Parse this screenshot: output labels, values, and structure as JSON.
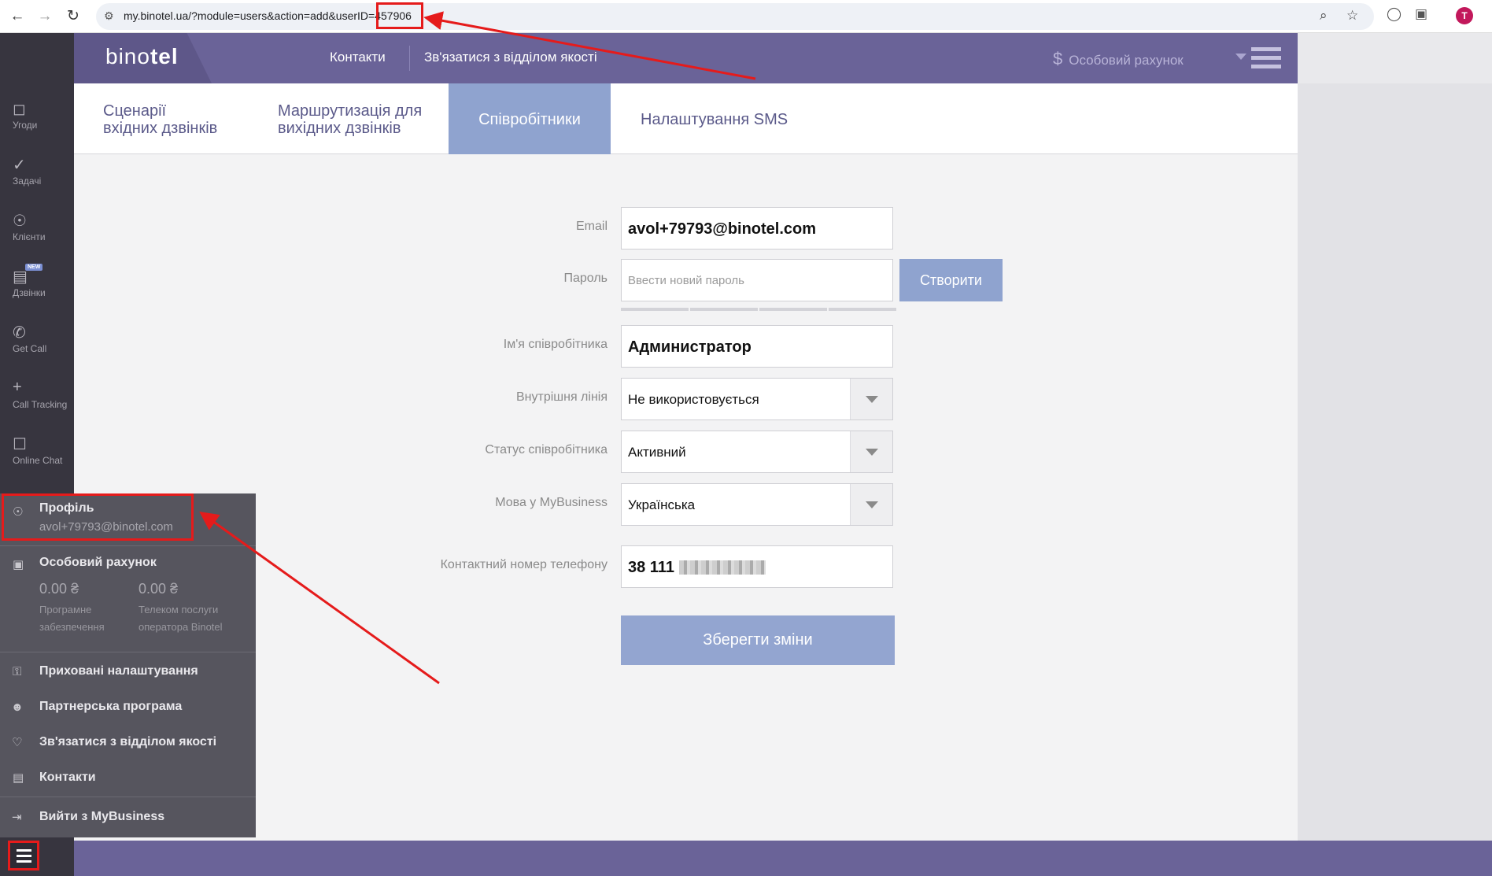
{
  "browser": {
    "url_prefix": "my.binotel.ua/?module=users&action=add&userID=",
    "url_id": "457906",
    "avatar_letter": "T"
  },
  "sidebar": {
    "items": [
      {
        "label": "Угоди",
        "icon": "deals-icon"
      },
      {
        "label": "Задачі",
        "icon": "check-icon"
      },
      {
        "label": "Клієнти",
        "icon": "person-icon"
      },
      {
        "label": "Дзвінки",
        "icon": "calls-icon",
        "badge": "NEW"
      },
      {
        "label": "Get Call",
        "icon": "phone-icon"
      },
      {
        "label": "Call Tracking",
        "icon": "crosshair-icon"
      },
      {
        "label": "Online Chat",
        "icon": "chat-icon"
      }
    ]
  },
  "header": {
    "logo_light": "bino",
    "logo_bold": "tel",
    "links": [
      "Контакти",
      "Зв'язатися з відділом якості"
    ],
    "account_label": "Особовий рахунок"
  },
  "tabs": [
    {
      "line1": "Сценарії",
      "line2": "вхідних дзвінків"
    },
    {
      "line1": "Маршрутизація для",
      "line2": "вихідних дзвінків"
    },
    {
      "line1": "Співробітники",
      "line2": "",
      "active": true
    },
    {
      "line1": "Налаштування SMS",
      "line2": ""
    }
  ],
  "form": {
    "email_label": "Email",
    "email_value": "avol+79793@binotel.com",
    "password_label": "Пароль",
    "password_placeholder": "Ввести новий пароль",
    "create_button": "Створити",
    "name_label": "Ім'я співробітника",
    "name_value": "Администратор",
    "line_label": "Внутрішня лінія",
    "line_value": "Не використовується",
    "status_label": "Статус співробітника",
    "status_value": "Активний",
    "language_label": "Мова у MyBusiness",
    "language_value": "Українська",
    "phone_label": "Контактний номер телефону",
    "phone_value": "38 111",
    "save_button": "Зберегти зміни"
  },
  "dropdown": {
    "profile_title": "Профіль",
    "profile_email": "avol+79793@binotel.com",
    "account_title": "Особовий рахунок",
    "software_amount": "0.00 ₴",
    "software_note_1": "Програмне",
    "software_note_2": "забезпечення",
    "telecom_amount": "0.00 ₴",
    "telecom_note_1": "Телеком послуги",
    "telecom_note_2": "оператора Binotel",
    "items": [
      "Приховані налаштування",
      "Партнерська програма",
      "Зв'язатися з відділом якості",
      "Контакти"
    ],
    "logout": "Вийти з MyBusiness"
  },
  "colors": {
    "header": "#6a6398",
    "sidebar": "#37353f",
    "accent": "#8fa3cf",
    "annotation": "#e51b1b"
  }
}
